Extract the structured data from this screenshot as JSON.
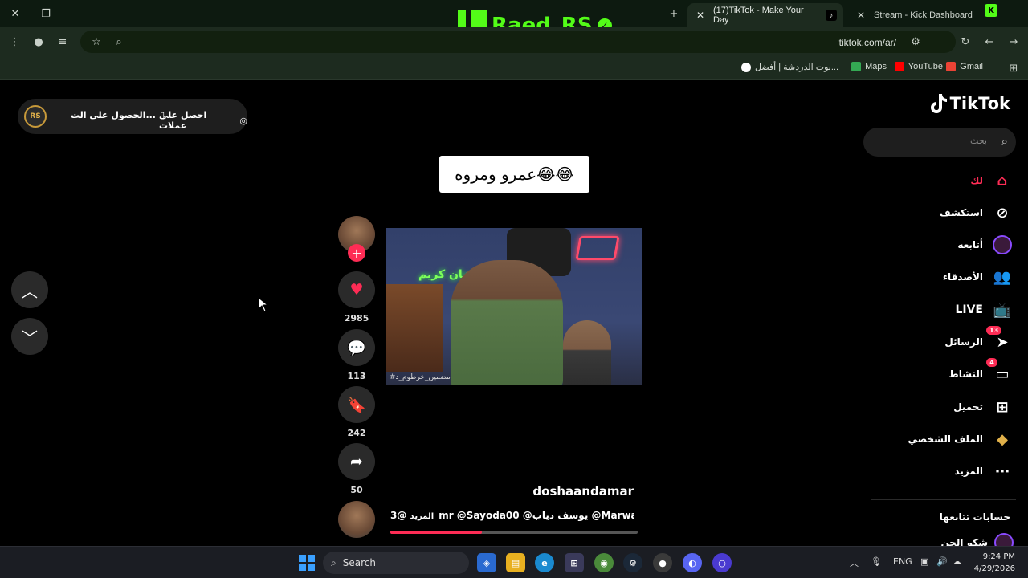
{
  "browser": {
    "tabs": [
      {
        "title": "(17)TikTok - Make Your Day",
        "active": true
      },
      {
        "title": "Stream - Kick Dashboard",
        "active": false
      }
    ],
    "url": "tiktok.com/ar/",
    "bookmarks": [
      "Gmail",
      "YouTube",
      "Maps",
      "بوت الدردشة | أفضل..."
    ],
    "overlay_name": "Raed_RS"
  },
  "tiktok": {
    "logo": "TikTok",
    "top_pill": {
      "get_coins": "احصل على عملات",
      "get_app": "الحصول على الت..."
    },
    "search_placeholder": "بحث",
    "sidebar": [
      {
        "label": "لك",
        "icon": "home-icon",
        "active": true
      },
      {
        "label": "استكشف",
        "icon": "compass-icon"
      },
      {
        "label": "أتابعه",
        "icon": "following-avatar-icon"
      },
      {
        "label": "الأصدقاء",
        "icon": "friends-icon"
      },
      {
        "label": "LIVE",
        "icon": "live-tv-icon"
      },
      {
        "label": "الرسائل",
        "icon": "messages-icon",
        "badge": "13"
      },
      {
        "label": "النشاط",
        "icon": "activity-icon",
        "badge": "4"
      },
      {
        "label": "تحميل",
        "icon": "upload-icon"
      },
      {
        "label": "الملف الشخصي",
        "icon": "profile-avatar-icon"
      },
      {
        "label": "المزيد",
        "icon": "more-icon"
      }
    ],
    "following_header": "حسابات تتابعها",
    "following_user": "شكو الجن",
    "video": {
      "caption": "عمرو ومروه😂😂",
      "video_text": "رمضان كريم",
      "hashtag_overlay": "#مضمين_خرطوم_د",
      "author": "doshaandamar",
      "description": "@3mr @Sayoda00 @يوسف دياب @Marwa...",
      "more": "المزيد",
      "progress": 0.37
    },
    "actions": {
      "likes": "2985",
      "comments": "113",
      "saves": "242",
      "shares": "50"
    }
  },
  "taskbar": {
    "search": "Search",
    "lang": "ENG",
    "time": "9:24 PM",
    "date": "4/29/2026"
  },
  "colors": {
    "accent": "#fe2c55",
    "kick_green": "#53fc18"
  }
}
